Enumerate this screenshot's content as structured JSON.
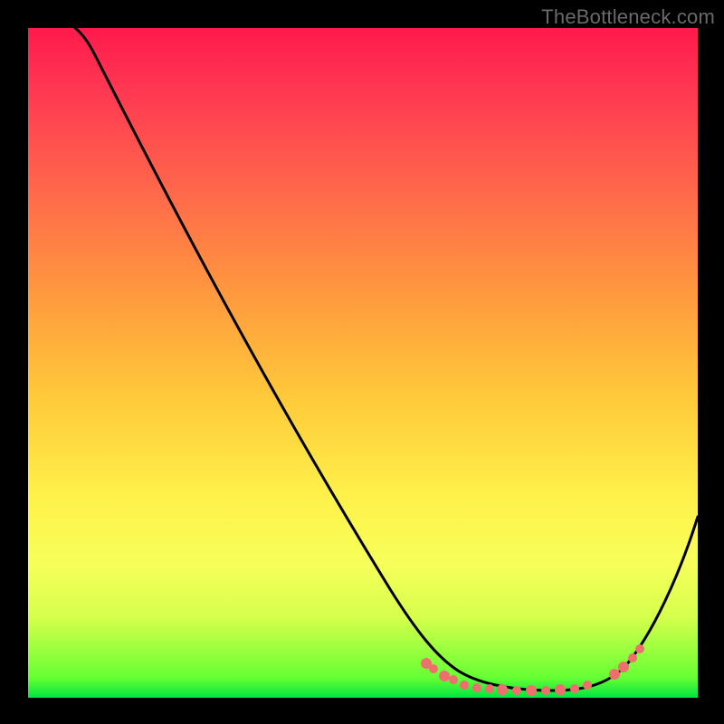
{
  "watermark": "TheBottleneck.com",
  "chart_data": {
    "type": "line",
    "title": "",
    "xlabel": "",
    "ylabel": "",
    "xlim": [
      0,
      100
    ],
    "ylim": [
      0,
      100
    ],
    "grid": false,
    "legend": false,
    "background": "rainbow-gradient",
    "series": [
      {
        "name": "bottleneck-curve",
        "color": "#000000",
        "x": [
          7,
          10,
          20,
          30,
          40,
          50,
          59,
          62,
          65,
          68,
          71,
          74,
          77,
          80,
          83,
          86,
          88,
          90,
          93,
          97,
          100
        ],
        "values": [
          100,
          97,
          85,
          71,
          57,
          43,
          29,
          24,
          19,
          14,
          10,
          7,
          5,
          4,
          4,
          4,
          5,
          7,
          12,
          21,
          30
        ]
      }
    ],
    "markers": {
      "name": "highlight-dots",
      "color": "#ef6f6f",
      "x": [
        59,
        62,
        65,
        66,
        70,
        73,
        75,
        77,
        79,
        81,
        83,
        85,
        87,
        88,
        90,
        92
      ],
      "values": [
        5,
        4,
        4,
        4,
        4,
        4,
        4,
        4,
        4,
        4,
        4,
        4,
        5,
        5,
        7,
        9
      ]
    }
  }
}
